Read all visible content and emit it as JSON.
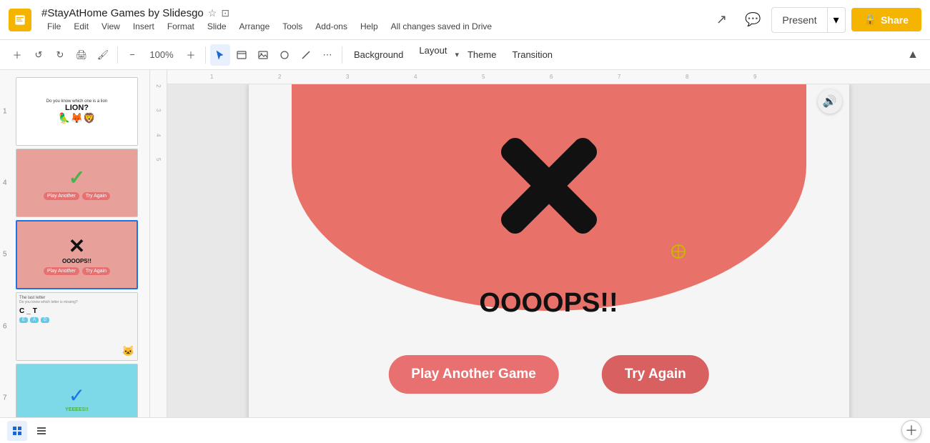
{
  "app": {
    "title": "#StayAtHome Games by Slidesgo",
    "icon_color": "#f4b400",
    "saved_text": "All changes saved in Drive"
  },
  "menu": {
    "items": [
      "File",
      "Edit",
      "View",
      "Insert",
      "Format",
      "Slide",
      "Arrange",
      "Tools",
      "Add-ons",
      "Help"
    ]
  },
  "toolbar": {
    "zoom": "100%",
    "background_label": "Background",
    "layout_label": "Layout",
    "theme_label": "Theme",
    "transition_label": "Transition"
  },
  "header": {
    "present_label": "Present",
    "share_label": "Share"
  },
  "slides": [
    {
      "num": 1,
      "label": "Slide 1"
    },
    {
      "num": 4,
      "label": "Slide 4"
    },
    {
      "num": 5,
      "label": "Slide 5"
    },
    {
      "num": 6,
      "label": "Slide 6"
    },
    {
      "num": 7,
      "label": "Slide 7"
    }
  ],
  "main_slide": {
    "oooops_text": "OOOOPS!!",
    "play_again_label": "Play Another Game",
    "try_again_label": "Try Again"
  },
  "slide6": {
    "title": "The last letter",
    "question": "Do you know which letter is missing?"
  }
}
